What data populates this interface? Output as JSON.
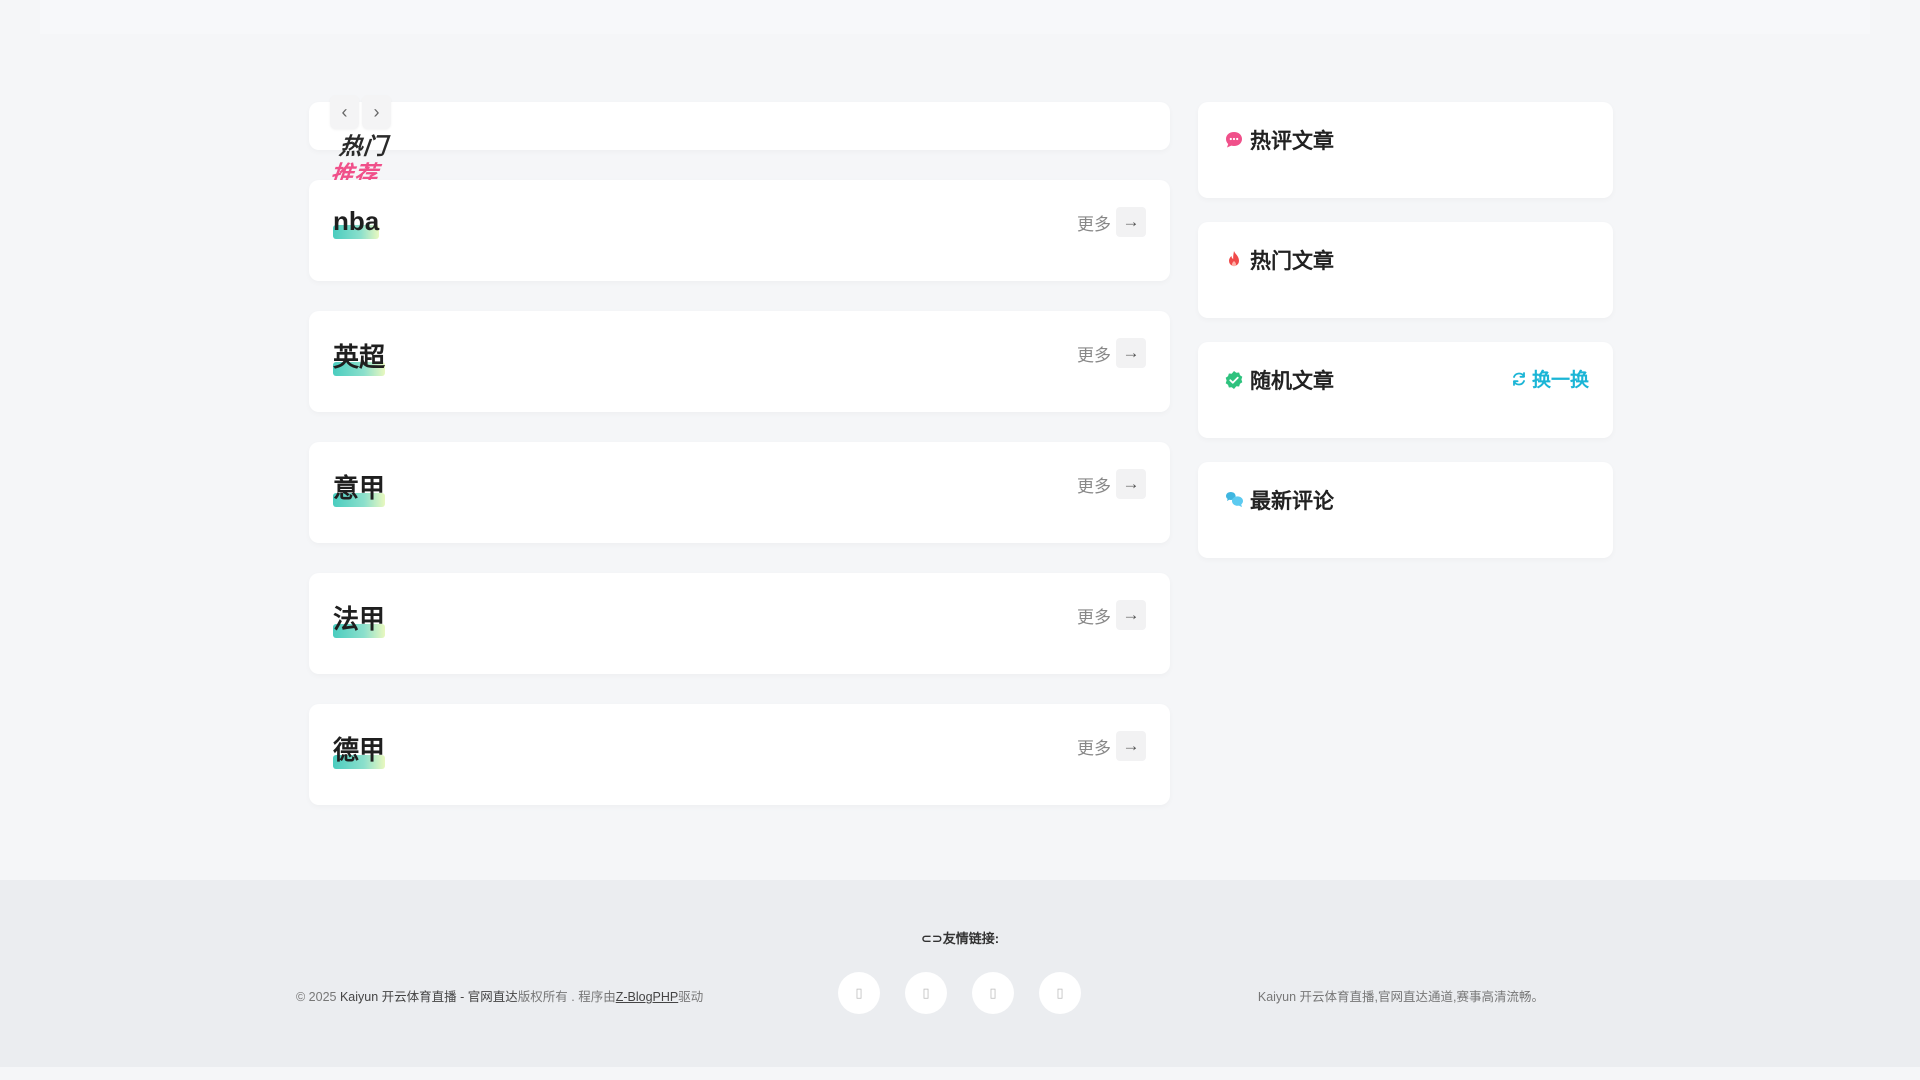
{
  "slider": {
    "prev_icon": "chevron-left-icon",
    "next_icon": "chevron-right-icon",
    "badge_line1": "热门",
    "badge_line2": "推荐"
  },
  "categories": [
    {
      "title": "nba",
      "more_label": "更多"
    },
    {
      "title": "英超",
      "more_label": "更多"
    },
    {
      "title": "意甲",
      "more_label": "更多"
    },
    {
      "title": "法甲",
      "more_label": "更多"
    },
    {
      "title": "德甲",
      "more_label": "更多"
    }
  ],
  "sidebar": {
    "widgets": [
      {
        "title": "热评文章",
        "icon": "chat-bubble-icon",
        "color": "#f0508a"
      },
      {
        "title": "热门文章",
        "icon": "flame-icon",
        "color": "#f04a4a"
      },
      {
        "title": "随机文章",
        "icon": "check-badge-icon",
        "color": "#2ec27e",
        "action": "换一换",
        "action_color": "#1bb5d6"
      },
      {
        "title": "最新评论",
        "icon": "comments-icon",
        "color": "#3fb6e0"
      }
    ]
  },
  "footer": {
    "friend_links_label": "友情链接:",
    "copyright_prefix": "© 2025 ",
    "site_name": "Kaiyun 开云体育直播 - 官网直达",
    "rights_text": "版权所有 . 程序由",
    "driver": "Z-BlogPHP",
    "driver_suffix": "驱动",
    "description": "Kaiyun 开云体育直播,官网直达通道,赛事高清流畅。",
    "socials": [
      "social-icon-1",
      "social-icon-2",
      "social-icon-3",
      "social-icon-4"
    ]
  }
}
